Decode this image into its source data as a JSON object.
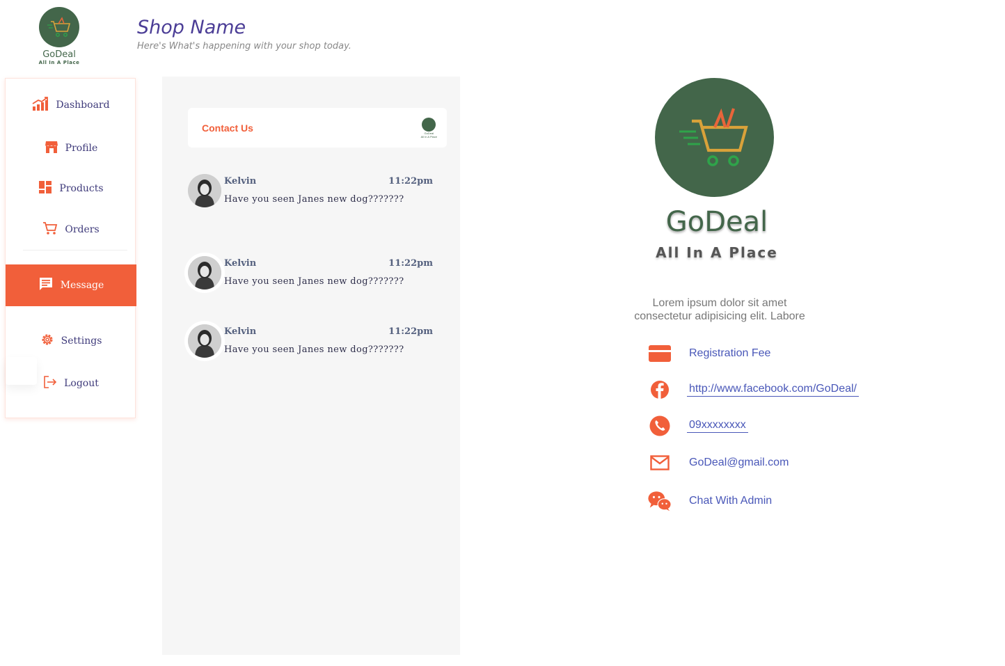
{
  "brand": {
    "name": "GoDeal",
    "tagline": "All In A Place"
  },
  "header": {
    "title": "Shop Name",
    "subtitle": "Here's  What's happening with your shop today."
  },
  "sidebar": {
    "items": [
      {
        "label": "Dashboard",
        "icon": "chart-icon"
      },
      {
        "label": "Profile",
        "icon": "store-icon"
      },
      {
        "label": "Products",
        "icon": "grid-icon"
      },
      {
        "label": "Orders",
        "icon": "cart-icon"
      },
      {
        "label": "Message",
        "icon": "message-icon",
        "active": true
      },
      {
        "label": "Settings",
        "icon": "gear-icon"
      },
      {
        "label": "Logout",
        "icon": "logout-icon"
      }
    ]
  },
  "contact": {
    "title": "Contact Us"
  },
  "messages": [
    {
      "sender": "Kelvin",
      "time": "11:22pm",
      "text": "Have you seen Janes new dog???????"
    },
    {
      "sender": "Kelvin",
      "time": "11:22pm",
      "text": "Have you seen Janes new dog???????"
    },
    {
      "sender": "Kelvin",
      "time": "11:22pm",
      "text": "Have you seen Janes new dog???????"
    }
  ],
  "profile": {
    "name": "GoDeal",
    "tagline": "All In A Place",
    "description_line1": "Lorem ipsum dolor sit amet",
    "description_line2": "consectetur adipisicing elit. Labore",
    "registration_fee": "Registration Fee",
    "facebook": "http://www.facebook.com/GoDeal/",
    "phone": "09xxxxxxxx",
    "email": "GoDeal@gmail.com",
    "chat": "Chat With Admin"
  },
  "colors": {
    "accent": "#f15f3a",
    "brand_green": "#43664a",
    "link_blue": "#4957b8",
    "nav_text": "#3e3a7a"
  }
}
